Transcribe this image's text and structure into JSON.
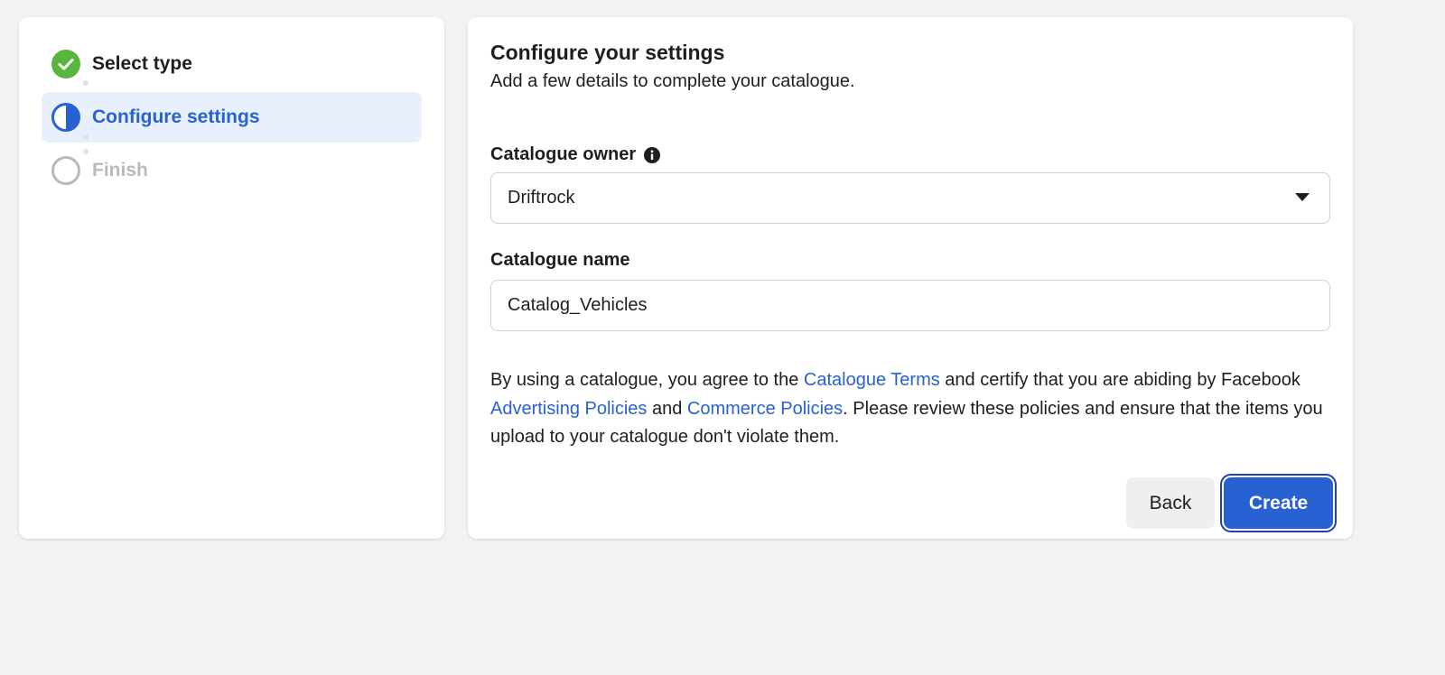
{
  "steps": [
    {
      "label": "Select type",
      "state": "done"
    },
    {
      "label": "Configure settings",
      "state": "active"
    },
    {
      "label": "Finish",
      "state": "pending"
    }
  ],
  "form": {
    "title": "Configure your settings",
    "subtitle": "Add a few details to complete your catalogue.",
    "owner_label": "Catalogue owner",
    "owner_value": "Driftrock",
    "name_label": "Catalogue name",
    "name_value": "Catalog_Vehicles"
  },
  "terms": {
    "part1": "By using a catalogue, you agree to the ",
    "link1": "Catalogue Terms",
    "part2": " and certify that you are abiding by Facebook ",
    "link2": "Advertising Policies",
    "part3": " and ",
    "link3": "Commerce Policies",
    "part4": ". Please review these policies and ensure that the items you upload to your catalogue don't violate them."
  },
  "buttons": {
    "back_label": "Back",
    "create_label": "Create"
  },
  "colors": {
    "accent": "#2861d2",
    "done_green": "#58b63d",
    "pending_gray": "#b7b9bd",
    "active_bg": "#e9f0fd"
  },
  "icons": {
    "step_done": "check-circle-icon",
    "step_active": "half-circle-icon",
    "step_pending": "empty-circle-icon",
    "owner_info": "info-icon",
    "owner_dropdown": "caret-down-icon"
  }
}
